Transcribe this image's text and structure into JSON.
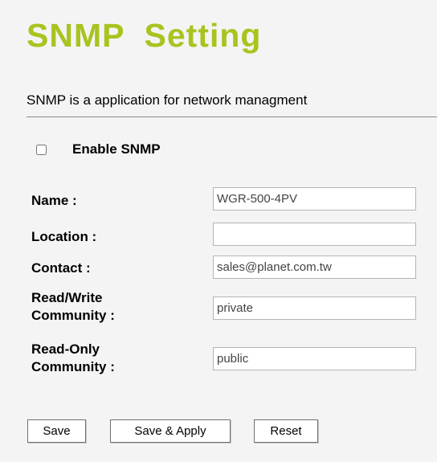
{
  "header": {
    "title": "SNMP  Setting",
    "description": "SNMP is a application for network managment"
  },
  "enable": {
    "label": "Enable SNMP",
    "checked": false
  },
  "fields": {
    "name": {
      "label": "Name :",
      "value": "WGR-500-4PV"
    },
    "location": {
      "label": "Location :",
      "value": ""
    },
    "contact": {
      "label": "Contact :",
      "value": "sales@planet.com.tw"
    },
    "rw_community": {
      "label_line1": "Read/Write",
      "label_line2": "Community :",
      "value": "private"
    },
    "ro_community": {
      "label_line1": "Read-Only",
      "label_line2": "Community :",
      "value": "public"
    }
  },
  "buttons": {
    "save": "Save",
    "save_apply": "Save & Apply",
    "reset": "Reset"
  },
  "colors": {
    "title": "#a7c41f",
    "background": "#f4f4f4"
  }
}
